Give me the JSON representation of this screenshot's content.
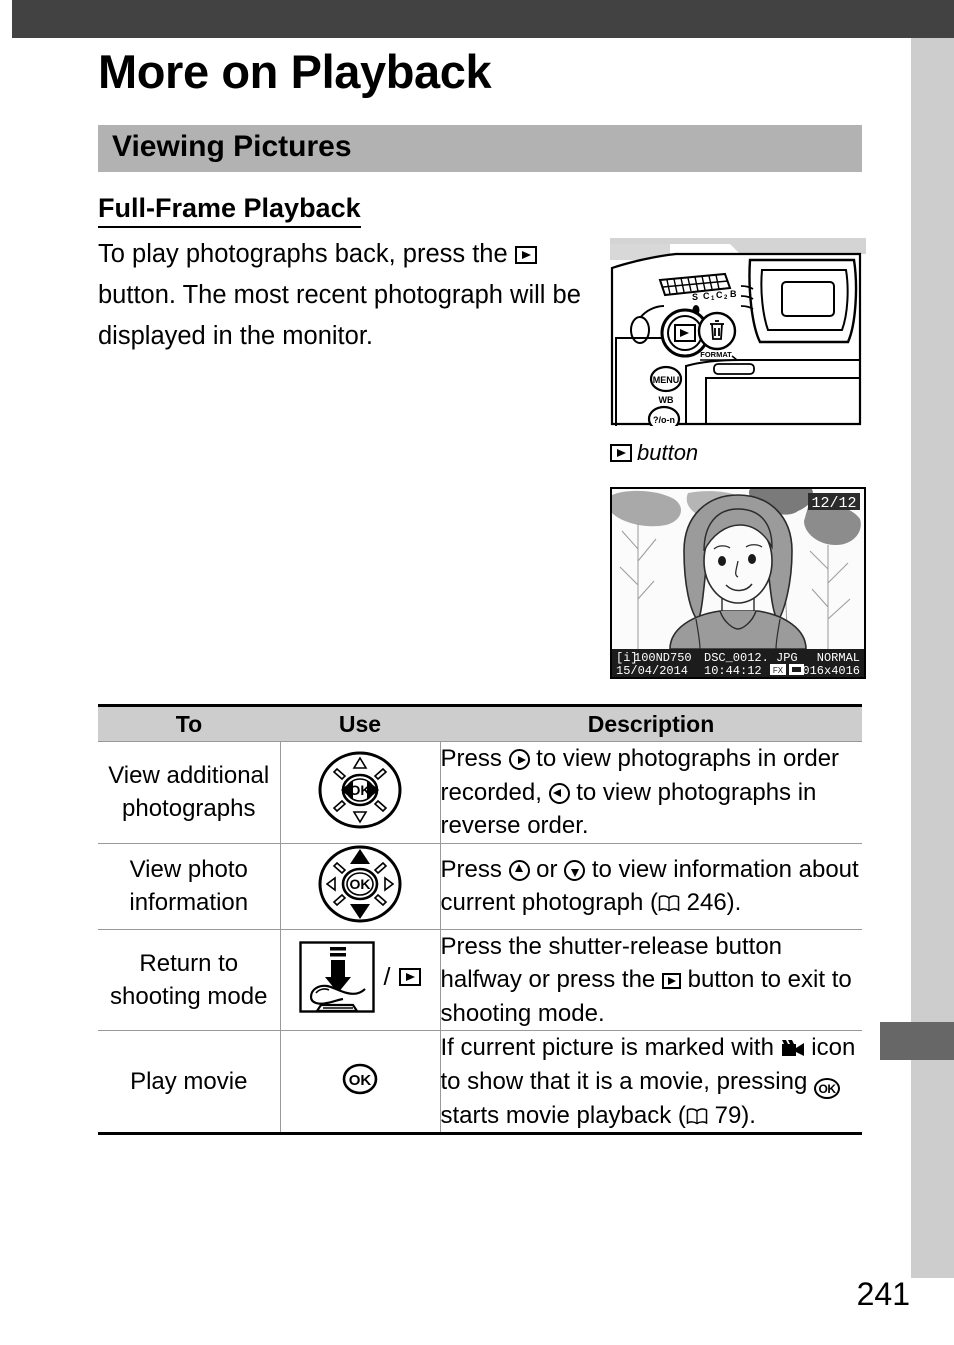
{
  "page": {
    "chapter_title": "More on Playback",
    "section_title": "Viewing Pictures",
    "subsection_title": "Full-Frame Playback",
    "page_number": "241"
  },
  "intro": {
    "part1": "To play photographs back, press the ",
    "part2": " button. The most recent photograph will be displayed in the monitor."
  },
  "figure": {
    "caption_text": "button",
    "caption_icon": "playback-icon"
  },
  "monitor": {
    "frame_counter": "12/12",
    "folder": "100ND750",
    "filename": "DSC_0012. JPG",
    "quality": "NORMAL",
    "date": "15/04/2014",
    "time": "10:44:12",
    "format_badge": "FX",
    "dimensions": "6016x4016",
    "protect_icon": "key-icon",
    "image_size_icon": "image-size-icon"
  },
  "table": {
    "headers": [
      "To",
      "Use",
      "Description"
    ],
    "rows": [
      {
        "to": "View additional photographs",
        "use_icon": "multi-selector-left-right-icon",
        "desc": {
          "t1": "Press ",
          "i1": "right-arrow-icon",
          "t2": " to view photographs in order recorded, ",
          "i2": "left-arrow-icon",
          "t3": " to view photographs in reverse order."
        }
      },
      {
        "to": "View photo information",
        "use_icon": "multi-selector-up-down-icon",
        "desc": {
          "t1": "Press ",
          "i1": "up-arrow-icon",
          "t2": " or ",
          "i2": "down-arrow-icon",
          "t3": " to view information about current photograph (",
          "i3": "book-reference-icon",
          "t4": " 246)."
        }
      },
      {
        "to": "Return to shooting mode",
        "use_icon": "shutter-release-halfway-icon",
        "use_separator": "/",
        "use_icon2": "playback-icon",
        "desc": {
          "t1": "Press the shutter-release button halfway or press the ",
          "i1": "playback-icon",
          "t2": " button to exit to shooting mode."
        }
      },
      {
        "to": "Play movie",
        "use_icon": "ok-button-icon",
        "desc": {
          "t1": "If current picture is marked with ",
          "i1": "movie-icon",
          "t2": " icon to show that it is a movie, pressing ",
          "i2": "ok-button-icon",
          "t3": " starts movie playback (",
          "i3": "book-reference-icon",
          "t4": " 79)."
        }
      }
    ]
  },
  "colors": {
    "top_bar": "#424242",
    "side_bar": "#cdcdcd",
    "side_tab": "#676767",
    "section_bar": "#b2b2b2",
    "table_header": "#cdcdcd"
  }
}
